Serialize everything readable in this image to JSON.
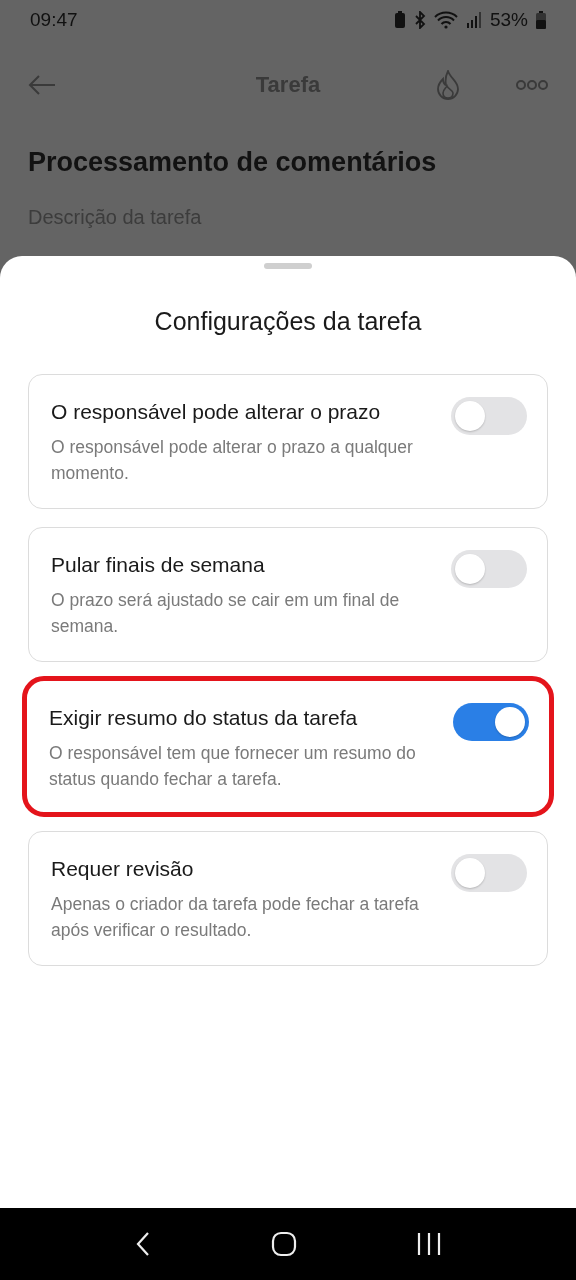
{
  "status_bar": {
    "time": "09:47",
    "battery": "53%"
  },
  "header": {
    "title": "Tarefa"
  },
  "task": {
    "title": "Processamento de comentários",
    "description_placeholder": "Descrição da tarefa"
  },
  "sheet": {
    "title": "Configurações da tarefa",
    "settings": [
      {
        "title": "O responsável pode alterar o prazo",
        "description": "O responsável pode alterar o prazo a qualquer momento.",
        "on": false,
        "highlighted": false
      },
      {
        "title": "Pular finais de semana",
        "description": "O prazo será ajustado se cair em um final de semana.",
        "on": false,
        "highlighted": false
      },
      {
        "title": "Exigir resumo do status da tarefa",
        "description": "O responsável tem que fornecer um resumo do status quando fechar a tarefa.",
        "on": true,
        "highlighted": true
      },
      {
        "title": "Requer revisão",
        "description": "Apenas o criador da tarefa pode fechar a tarefa após verificar o resultado.",
        "on": false,
        "highlighted": false
      }
    ]
  }
}
